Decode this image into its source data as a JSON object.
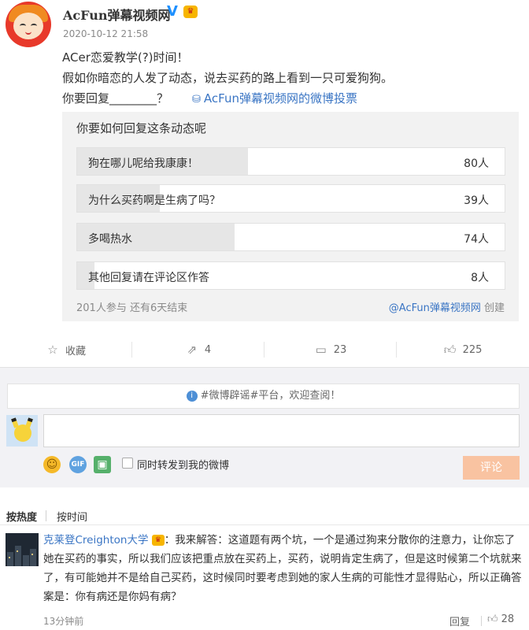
{
  "post": {
    "author": "AcFun弹幕视频网",
    "timestamp": "2020-10-12 21:58",
    "lines": [
      "ACer恋爱教学(?)时间！",
      "假如你暗恋的人发了动态，说去买药的路上看到一只可爱狗狗。",
      "你要回复________？"
    ],
    "poll_link": "AcFun弹幕视频网的微博投票"
  },
  "poll": {
    "question": "你要如何回复这条动态呢",
    "options": [
      {
        "label": "狗在哪儿呢给我康康！",
        "count": "80人",
        "share": 0.4
      },
      {
        "label": "为什么买药啊是生病了吗？",
        "count": "39人",
        "share": 0.194
      },
      {
        "label": "多喝热水",
        "count": "74人",
        "share": 0.368
      },
      {
        "label": "其他回复请在评论区作答",
        "count": "8人",
        "share": 0.04
      }
    ],
    "footer": "201人参与  还有6天结束",
    "creator_name": "@AcFun弹幕视频网",
    "creator_suffix": " 创建"
  },
  "actions": {
    "favorite": "收藏",
    "repost": "4",
    "comment": "23",
    "like": "225"
  },
  "comment_box": {
    "notice_topic": "#微博辟谣#",
    "notice_text": "平台，欢迎查阅！",
    "input_value": "",
    "repost_label": "同时转发到我的微博",
    "submit_label": "评论"
  },
  "sort": {
    "hot": "按热度",
    "time": "按时间"
  },
  "comment": {
    "name": "克莱登Creighton大学",
    "text": "：我来解答：这道题有两个坑，一个是通过狗来分散你的注意力，让你忘了她在买药的事实，所以我们应该把重点放在买药上，买药，说明肯定生病了，但是这时候第二个坑就来了，有可能她并不是给自己买药，这时候同时要考虑到她的家人生病的可能性才显得贴心，所以正确答案是：你有病还是你妈有病？",
    "time": "13分钟前",
    "reply": "回复",
    "likes": "28"
  },
  "colors": {
    "link": "#3a75c4",
    "poll_bg": "#f2f2f2",
    "submit_disabled": "#f9c3a1"
  }
}
